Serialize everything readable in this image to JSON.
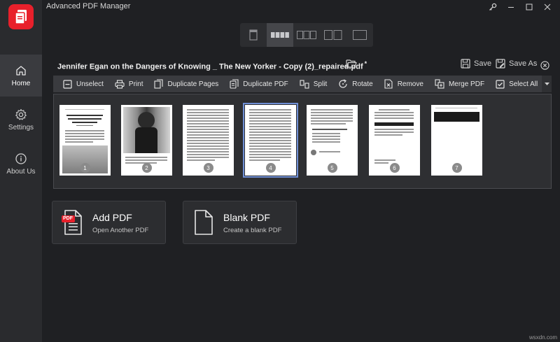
{
  "window": {
    "title": "Advanced PDF Manager",
    "controls": [
      "key-icon",
      "minimize-icon",
      "maximize-icon",
      "close-icon"
    ]
  },
  "sidebar": {
    "items": [
      {
        "label": "Home",
        "icon": "home-icon",
        "active": true
      },
      {
        "label": "Settings",
        "icon": "gear-icon",
        "active": false
      },
      {
        "label": "About Us",
        "icon": "info-icon",
        "active": false
      }
    ]
  },
  "view_modes": [
    "single-page-view-icon",
    "strip-view-icon",
    "three-column-view-icon",
    "two-column-view-icon",
    "wide-view-icon"
  ],
  "document": {
    "name": "Jennifer Egan on the Dangers of Knowing _ The New Yorker - Copy (2)_repaired.pdf",
    "modified_marker": "*",
    "save_label": "Save",
    "save_as_label": "Save As"
  },
  "toolbar": {
    "unselect": "Unselect",
    "print": "Print",
    "duplicate_pages": "Duplicate Pages",
    "duplicate_pdf": "Duplicate PDF",
    "split": "Split",
    "rotate": "Rotate",
    "remove": "Remove",
    "merge_pdf": "Merge PDF",
    "select_all": "Select All"
  },
  "pages": [
    {
      "number": "1",
      "selected": false
    },
    {
      "number": "2",
      "selected": false
    },
    {
      "number": "3",
      "selected": false
    },
    {
      "number": "4",
      "selected": true
    },
    {
      "number": "5",
      "selected": false
    },
    {
      "number": "6",
      "selected": false
    },
    {
      "number": "7",
      "selected": false
    }
  ],
  "cards": {
    "add_pdf": {
      "title": "Add PDF",
      "subtitle": "Open Another PDF",
      "badge": "PDF"
    },
    "blank_pdf": {
      "title": "Blank PDF",
      "subtitle": "Create a blank PDF"
    }
  },
  "watermark": "wsxdn.com",
  "colors": {
    "background": "#1f2023",
    "sidebar": "#2a2b2e",
    "toolbar": "#3a3b3f",
    "brand_red": "#e8202b",
    "selection": "#6f8fd6"
  }
}
